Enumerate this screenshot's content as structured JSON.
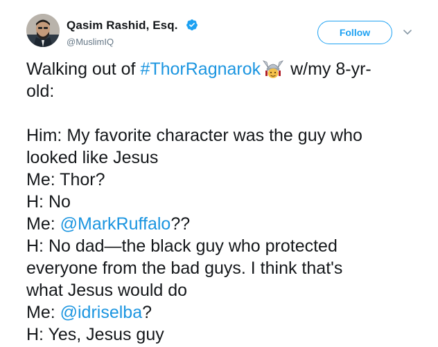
{
  "user": {
    "display_name": "Qasim Rashid, Esq.",
    "handle": "@MuslimIQ",
    "avatar_icon": "profile-photo",
    "verified_icon": "verified-badge-icon"
  },
  "actions": {
    "follow_label": "Follow",
    "menu_icon": "chevron-down-icon"
  },
  "colors": {
    "accent": "#1da1f2",
    "link": "#1b95e0",
    "text": "#14171a",
    "secondary": "#657786"
  },
  "tweet": {
    "line1_prefix": "Walking out of ",
    "line1_hashtag": "#ThorRagnarok",
    "line1_emoji": "thor-helmet-emoji-icon",
    "line1_suffix": " w/my 8-yr-",
    "line2": "old:",
    "line3": "Him: My favorite character was the guy who",
    "line4": "looked like Jesus",
    "line5": "Me: Thor?",
    "line6": "H: No",
    "line7_prefix": "Me: ",
    "line7_mention": "@MarkRuffalo",
    "line7_suffix": "??",
    "line8": "H: No dad—the black guy who protected",
    "line9": "everyone from the bad guys. I think that's",
    "line10": "what Jesus would do",
    "line11_prefix": "Me: ",
    "line11_mention": "@idriselba",
    "line11_suffix": "?",
    "line12": "H: Yes, Jesus guy"
  }
}
